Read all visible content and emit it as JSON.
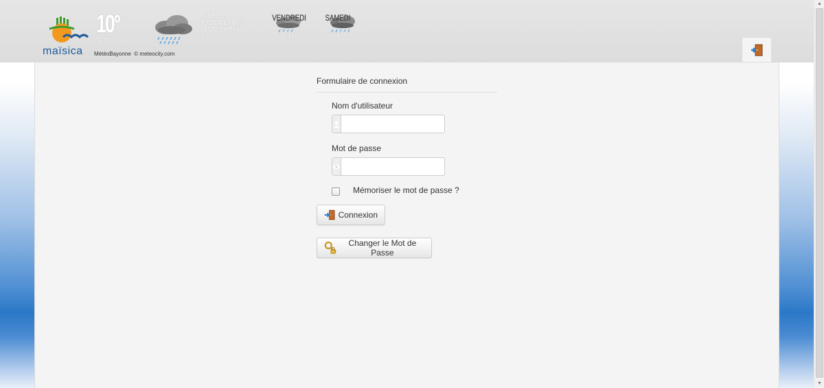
{
  "header": {
    "logo_text": "maïsica",
    "weather": {
      "temperature": "10°",
      "date": "JEUDI 4 DEC",
      "conditions": [
        "AVERSES",
        "HUMIDITÉ : 94%",
        "VENT : 5 KM/H",
        "S.S.O."
      ],
      "credit_source": "MétéoBayonne",
      "credit_site": "© meteocity.com",
      "forecast": [
        {
          "day": "VENDREDI",
          "range": "3°/11°"
        },
        {
          "day": "SAMEDI",
          "range": "6°/9°"
        }
      ]
    }
  },
  "form": {
    "title": "Formulaire de connexion",
    "username_label": "Nom d'utilisateur",
    "username_value": "",
    "password_label": "Mot de passe",
    "password_value": "",
    "remember_label": "Mémoriser le mot de passe ?",
    "remember_checked": false,
    "login_button": "Connexion",
    "change_password_button": "Changer le Mot de Passe"
  },
  "icons": {
    "user": "user-icon",
    "eye": "eye-icon",
    "door": "door-exit-icon",
    "key": "keys-lock-icon",
    "weather": "cloud-rain-icon"
  },
  "colors": {
    "logo_blue": "#1f5a9a",
    "logo_green": "#3f9a2d",
    "logo_orange": "#f29a1f",
    "background_blue": "#2a78c7",
    "panel": "#f4f4f4"
  }
}
